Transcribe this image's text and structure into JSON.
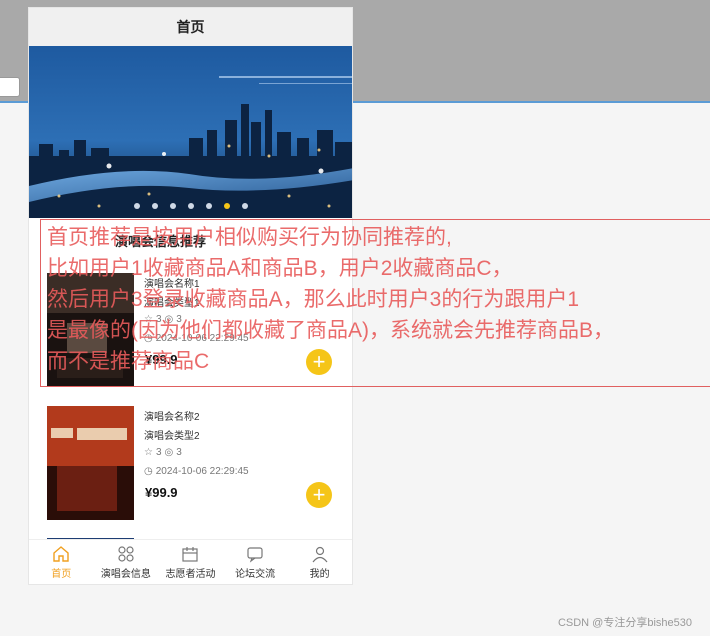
{
  "app": {
    "title": "首页"
  },
  "banner": {
    "slide_count": 7,
    "active_slide": 6
  },
  "section": {
    "title": "演唱会信息推荐"
  },
  "cards": [
    {
      "name": "演唱会名称1",
      "type": "演唱会类型1",
      "likes": "3",
      "views": "3",
      "time": "2024-10-06 22:29:45",
      "price": "¥99.9"
    },
    {
      "name": "演唱会名称2",
      "type": "演唱会类型2",
      "likes": "3",
      "views": "3",
      "time": "2024-10-06 22:29:45",
      "price": "¥99.9"
    }
  ],
  "tabbar": [
    {
      "label": "首页",
      "icon": "home-icon",
      "active": true
    },
    {
      "label": "演唱会信息",
      "icon": "grid-icon",
      "active": false
    },
    {
      "label": "志愿者活动",
      "icon": "calendar-icon",
      "active": false
    },
    {
      "label": "论坛交流",
      "icon": "chat-icon",
      "active": false
    },
    {
      "label": "我的",
      "icon": "user-icon",
      "active": false
    }
  ],
  "annotation": {
    "lines": [
      "首页推荐是按用户相似购买行为协同推荐的,",
      "比如用户1收藏商品A和商品B，用户2收藏商品C，",
      "然后用户3登录收藏商品A，那么此时用户3的行为跟用户1",
      "是最像的(因为他们都收藏了商品A)，系统就会先推荐商品B，",
      "而不是推荐商品C"
    ]
  },
  "watermark": "CSDN @专注分享bishe530",
  "colors": {
    "accent": "#f5c518",
    "annotation": "#e85b5b",
    "active_tab": "#f0a020"
  }
}
